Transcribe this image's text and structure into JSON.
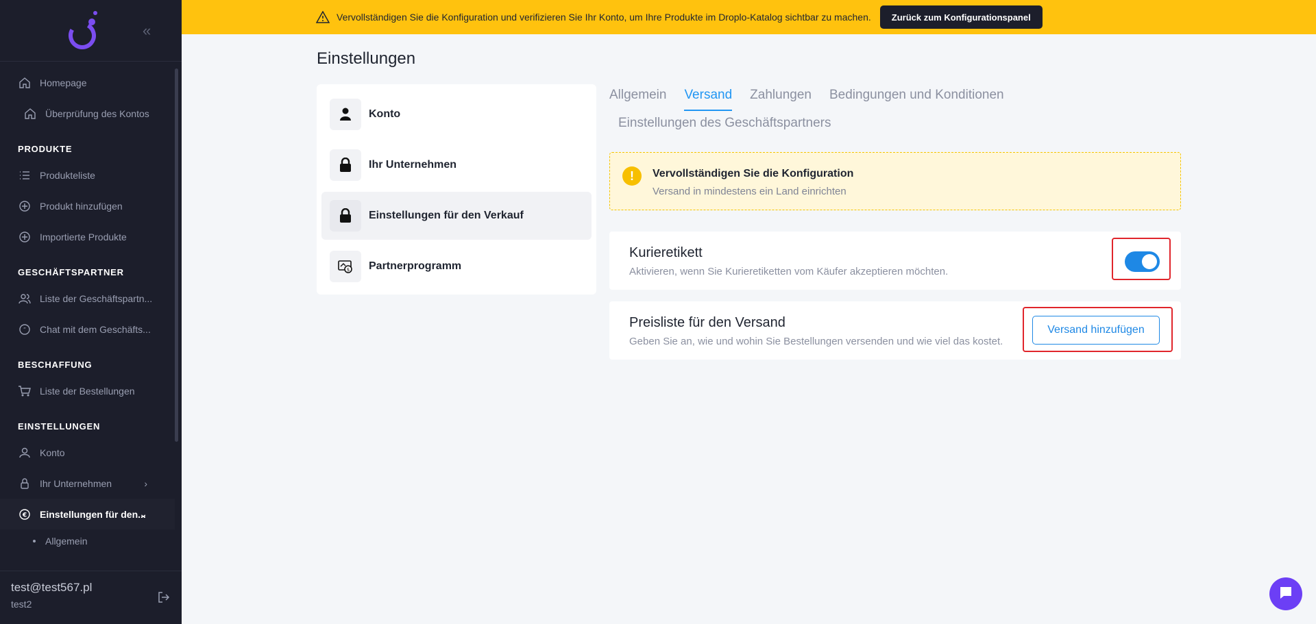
{
  "banner": {
    "message": "Vervollständigen Sie die Konfiguration und verifizieren Sie Ihr Konto, um Ihre Produkte im Droplo-Katalog sichtbar zu machen.",
    "button": "Zurück zum Konfigurationspanel"
  },
  "sidebar": {
    "collapse_icon": "double-chevron-left-icon",
    "items": {
      "homepage": "Homepage",
      "verify": "Überprüfung des Kontos",
      "section_products": "PRODUKTE",
      "product_list": "Produkteliste",
      "add_product": "Produkt hinzufügen",
      "imported": "Importierte Produkte",
      "section_partners": "GESCHÄFTSPARTNER",
      "partner_list": "Liste der Geschäftspartn...",
      "partner_chat": "Chat mit dem Geschäfts...",
      "section_procurement": "BESCHAFFUNG",
      "orders": "Liste der Bestellungen",
      "section_settings": "EINSTELLUNGEN",
      "account": "Konto",
      "company": "Ihr Unternehmen",
      "sales_settings": "Einstellungen für den...",
      "general": "Allgemein"
    },
    "user": {
      "email": "test@test567.pl",
      "name": "test2"
    }
  },
  "page": {
    "title": "Einstellungen"
  },
  "settings_menu": {
    "account": "Konto",
    "company": "Ihr Unternehmen",
    "sales": "Einstellungen für den Verkauf",
    "partner": "Partnerprogramm"
  },
  "tabs": {
    "general": "Allgemein",
    "shipping": "Versand",
    "payments": "Zahlungen",
    "terms": "Bedingungen und Konditionen",
    "partner_settings": "Einstellungen des Geschäftspartners"
  },
  "warning": {
    "icon": "!",
    "title": "Vervollständigen Sie die Konfiguration",
    "subtitle": "Versand in mindestens ein Land einrichten"
  },
  "courier": {
    "title": "Kurieretikett",
    "subtitle": "Aktivieren, wenn Sie Kurieretiketten vom Käufer akzeptieren möchten.",
    "enabled": true
  },
  "pricelist": {
    "title": "Preisliste für den Versand",
    "subtitle": "Geben Sie an, wie und wohin Sie Bestellungen versenden und wie viel das kostet.",
    "button": "Versand hinzufügen"
  },
  "colors": {
    "accent": "#1e88e5",
    "banner": "#ffc20e",
    "sidebar": "#1c1e2b",
    "highlight": "#e0252b",
    "chat": "#6c3ff5"
  }
}
